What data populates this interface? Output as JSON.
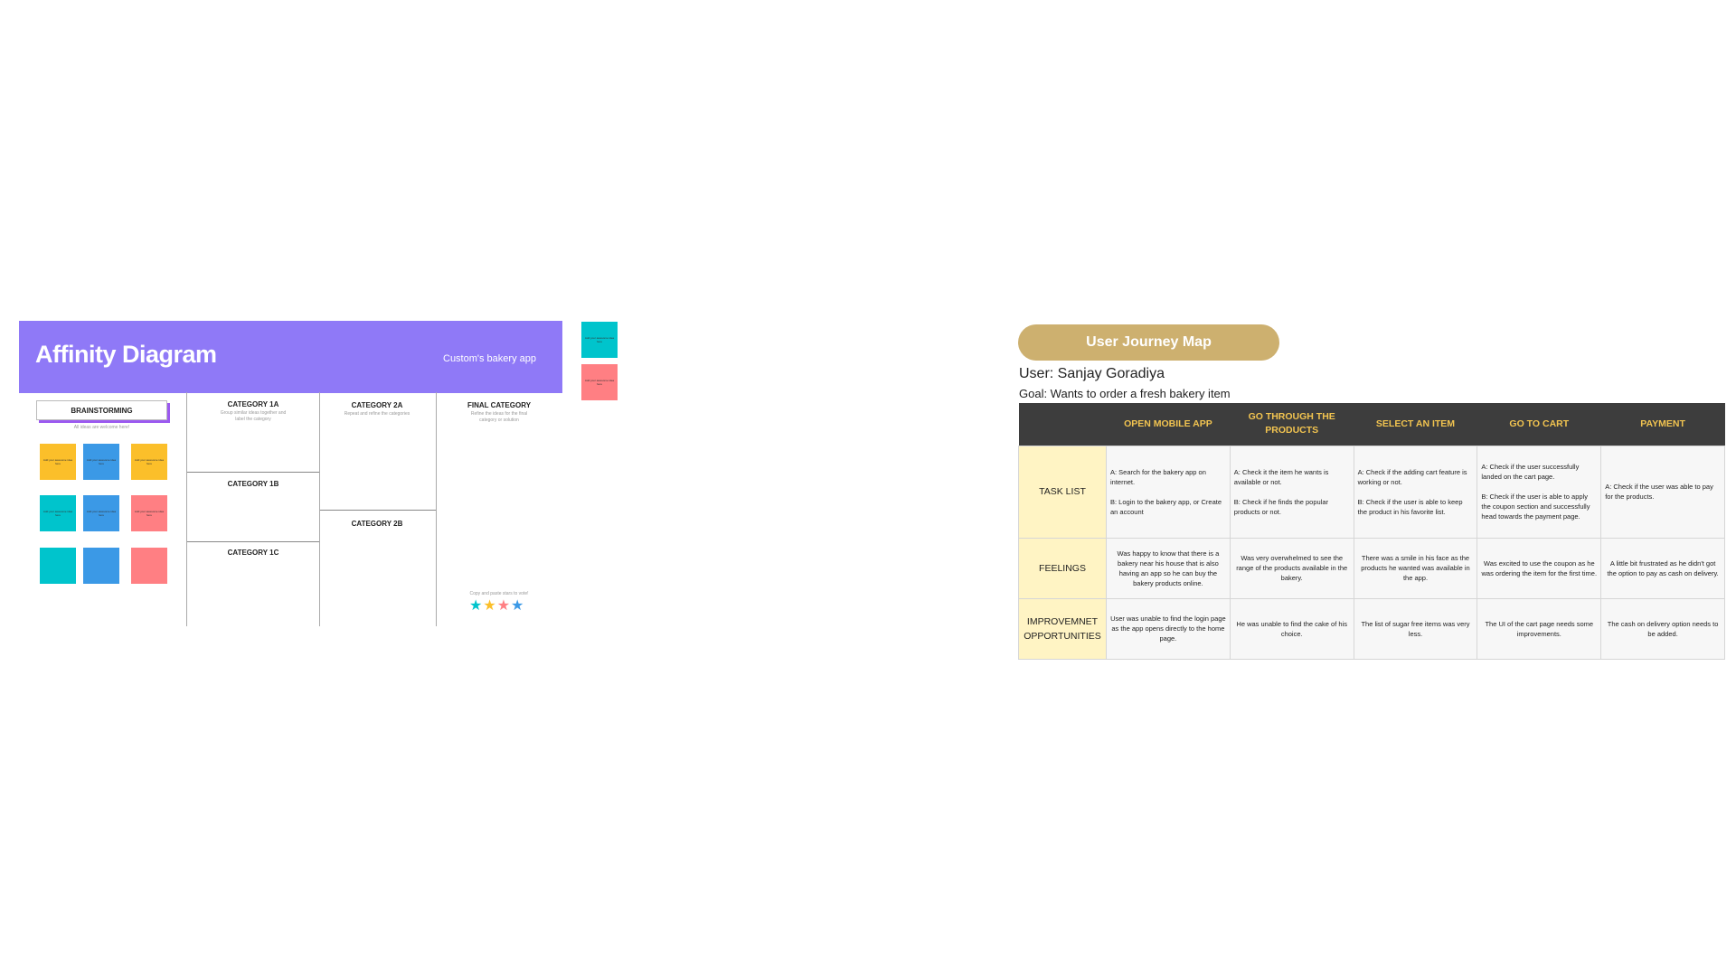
{
  "affinity": {
    "title": "Affinity Diagram",
    "subtitle": "Custom's bakery app",
    "brainstorming": "BRAINSTORMING",
    "brainstorming_hint": "All ideas are welcome here!",
    "sticky_text": "Add your awesome idea here",
    "stickies": [
      {
        "color": "#fbbf2a",
        "text": "Add your awesome idea here"
      },
      {
        "color": "#3b99e6",
        "text": "Add your awesome idea here"
      },
      {
        "color": "#fbbf2a",
        "text": "Add your awesome idea here"
      },
      {
        "color": "#00c4cc",
        "text": "Add your awesome idea here"
      },
      {
        "color": "#3b99e6",
        "text": "Add your awesome idea here"
      },
      {
        "color": "#ff7f83",
        "text": "Add your awesome idea here"
      },
      {
        "color": "#00c4cc",
        "text": ""
      },
      {
        "color": "#3b99e6",
        "text": ""
      },
      {
        "color": "#ff7f83",
        "text": ""
      }
    ],
    "side_stickies": [
      {
        "color": "#00c4cc",
        "text": "Add your awesome idea here"
      },
      {
        "color": "#ff7f83",
        "text": "Add your awesome idea here"
      }
    ],
    "categories": {
      "c1a": {
        "title": "CATEGORY 1A",
        "hint": "Group similar ideas together and label the category"
      },
      "c1b": {
        "title": "CATEGORY 1B"
      },
      "c1c": {
        "title": "CATEGORY 1C"
      },
      "c2a": {
        "title": "CATEGORY 2A",
        "hint": "Repeat and refine the categories"
      },
      "c2b": {
        "title": "CATEGORY 2B"
      },
      "final": {
        "title": "FINAL CATEGORY",
        "hint": "Refine the ideas for the final category or solution"
      }
    },
    "vote_hint": "Copy and paste stars to vote!",
    "stars": [
      "#00c4cc",
      "#fbbf2a",
      "#ff7f83",
      "#3b99e6"
    ]
  },
  "journey": {
    "title": "User Journey Map",
    "user": "User: Sanjay Goradiya",
    "goal": "Goal: Wants to order a fresh bakery item",
    "columns": [
      "OPEN MOBILE APP",
      "GO THROUGH THE PRODUCTS",
      "SELECT AN ITEM",
      "GO TO CART",
      "PAYMENT"
    ],
    "rows": [
      {
        "label": "TASK LIST",
        "cells": [
          "A: Search for the bakery app on internet.\n\nB: Login to the bakery app, or Create an account",
          "A: Check it the item he wants is available or not.\n\nB: Check if he finds the popular products or not.",
          "A: Check if the adding cart feature is working or not.\n\nB: Check if the user is able to keep the product in his favorite list.",
          "A: Check if the user successfully landed on the cart page.\n\nB: Check if the user is able to apply the coupon section and successfully head towards the payment page.",
          "A: Check if the user was able to pay for the products."
        ]
      },
      {
        "label": "FEELINGS",
        "cells": [
          "Was happy to know that there is a bakery near his house that is also having an app so he can buy the bakery products online.",
          "Was very overwhelmed to see the range of the products available in the bakery.",
          "There was a smile in his face as the products he wanted was available in the app.",
          "Was excited to use the coupon as he was ordering the item for the first time.",
          "A little bit frustrated as he didn't got the option to pay as cash on delivery."
        ]
      },
      {
        "label": "IMPROVEMNET OPPORTUNITIES",
        "cells": [
          "User was unable to find the login page as the app opens directly to the home page.",
          "He was unable to find the cake of his choice.",
          "The list of sugar free items was very less.",
          "The UI of the cart page needs some improvements.",
          "The cash on delivery option needs to be added."
        ]
      }
    ]
  }
}
